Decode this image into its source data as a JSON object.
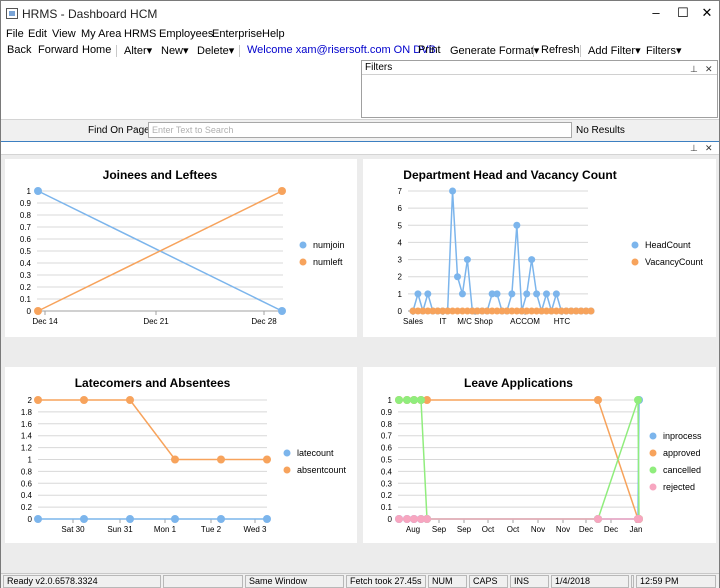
{
  "window": {
    "title": "HRMS - Dashboard HCM",
    "minimize": "‒",
    "maximize": "☐",
    "close": "✕"
  },
  "menu": [
    "File",
    "Edit",
    "View",
    "My Area",
    "HRMS",
    "Employees",
    "Enterprise",
    "Help"
  ],
  "toolbar": {
    "back": "Back",
    "forward": "Forward",
    "home": "Home",
    "alter": "Alter▾",
    "new": "New▾",
    "delete": "Delete▾",
    "welcome": "Welcome xam@risersoft.com ON DVB",
    "print": "Print",
    "generate_format": "Generate Format▾",
    "refresh": "Refresh",
    "add_filter": "Add Filter▾",
    "filters": "Filters▾"
  },
  "filters_panel": {
    "title": "Filters",
    "pin": "⊥",
    "close": "✕"
  },
  "find": {
    "label": "Find On Page",
    "placeholder": "Enter Text to Search",
    "result": "No Results"
  },
  "pane": {
    "pin": "⊥",
    "close": "✕"
  },
  "status": {
    "ready": "Ready v2.0.6578.3324",
    "blank": "",
    "mode": "Same Window",
    "fetch": "Fetch took 27.45s",
    "num": "NUM",
    "caps": "CAPS",
    "ins": "INS",
    "date": "1/4/2018",
    "blank2": "",
    "time": "12:59 PM"
  },
  "colors": {
    "blue": "#7cb5ec",
    "orange": "#f7a35c",
    "green": "#90ed7d",
    "pink": "#f7a6c0",
    "grid": "#d8d8d8"
  },
  "chart_data": [
    {
      "type": "line",
      "title": "Joinees and Leftees",
      "x_ticks": [
        "Dec 14",
        "Dec 21",
        "Dec 28"
      ],
      "x": [
        "Dec 14",
        "Dec 28"
      ],
      "ylim": [
        0,
        1
      ],
      "y_ticks": [
        "0",
        "0.1",
        "0.2",
        "0.3",
        "0.4",
        "0.5",
        "0.6",
        "0.7",
        "0.8",
        "0.9",
        "1"
      ],
      "series": [
        {
          "name": "numjoin",
          "values": [
            1,
            0
          ]
        },
        {
          "name": "numleft",
          "values": [
            0,
            1
          ]
        }
      ],
      "legend": "right"
    },
    {
      "type": "line",
      "title": "Department Head and Vacancy Count",
      "x_ticks": [
        "Sales",
        "IT",
        "M/C Shop",
        "ACCOM",
        "HTC"
      ],
      "ylim": [
        0,
        7
      ],
      "y_ticks": [
        "0",
        "1",
        "2",
        "3",
        "4",
        "5",
        "6",
        "7"
      ],
      "series": [
        {
          "name": "HeadCount",
          "values": [
            0,
            1,
            0,
            1,
            0,
            0,
            0,
            0,
            7,
            2,
            1,
            3,
            0,
            0,
            0,
            0,
            1,
            1,
            0,
            0,
            1,
            5,
            0,
            1,
            3,
            1,
            0,
            1,
            0,
            1,
            0,
            0,
            0,
            0,
            0,
            0,
            0
          ]
        },
        {
          "name": "VacancyCount",
          "values": [
            0,
            0,
            0,
            0,
            0,
            0,
            0,
            0,
            0,
            0,
            0,
            0,
            0,
            0,
            0,
            0,
            0,
            0,
            0,
            0,
            0,
            0,
            0,
            0,
            0,
            0,
            0,
            0,
            0,
            0,
            0,
            0,
            0,
            0,
            0,
            0,
            0
          ]
        }
      ],
      "legend": "right"
    },
    {
      "type": "line",
      "title": "Latecomers and Absentees",
      "x_ticks": [
        "Sat 30",
        "Sun 31",
        "Mon 1",
        "Tue 2",
        "Wed 3"
      ],
      "ylim": [
        0,
        2
      ],
      "y_ticks": [
        "0",
        "0.2",
        "0.4",
        "0.6",
        "0.8",
        "1",
        "1.2",
        "1.4",
        "1.6",
        "1.8",
        "2"
      ],
      "series": [
        {
          "name": "latecount",
          "values": [
            0,
            0,
            0,
            0,
            0,
            0
          ]
        },
        {
          "name": "absentcount",
          "values": [
            2,
            2,
            2,
            1,
            1,
            1
          ]
        }
      ],
      "legend": "right"
    },
    {
      "type": "line",
      "title": "Leave Applications",
      "x_ticks": [
        "Aug",
        "Sep",
        "Sep",
        "Oct",
        "Oct",
        "Nov",
        "Nov",
        "Dec",
        "Dec",
        "Jan"
      ],
      "ylim": [
        0,
        1
      ],
      "y_ticks": [
        "0",
        "0.1",
        "0.2",
        "0.3",
        "0.4",
        "0.5",
        "0.6",
        "0.7",
        "0.8",
        "0.9",
        "1"
      ],
      "series": [
        {
          "name": "inprocess",
          "values": [
            0,
            0,
            0,
            0,
            0,
            0,
            0,
            1
          ]
        },
        {
          "name": "approved",
          "values": [
            1,
            1,
            1,
            1,
            1,
            1,
            0,
            0
          ]
        },
        {
          "name": "cancelled",
          "values": [
            1,
            1,
            1,
            1,
            0,
            0,
            1,
            0
          ]
        },
        {
          "name": "rejected",
          "values": [
            0,
            0,
            0,
            0,
            0,
            0,
            0,
            0
          ]
        }
      ],
      "legend": "right"
    }
  ]
}
